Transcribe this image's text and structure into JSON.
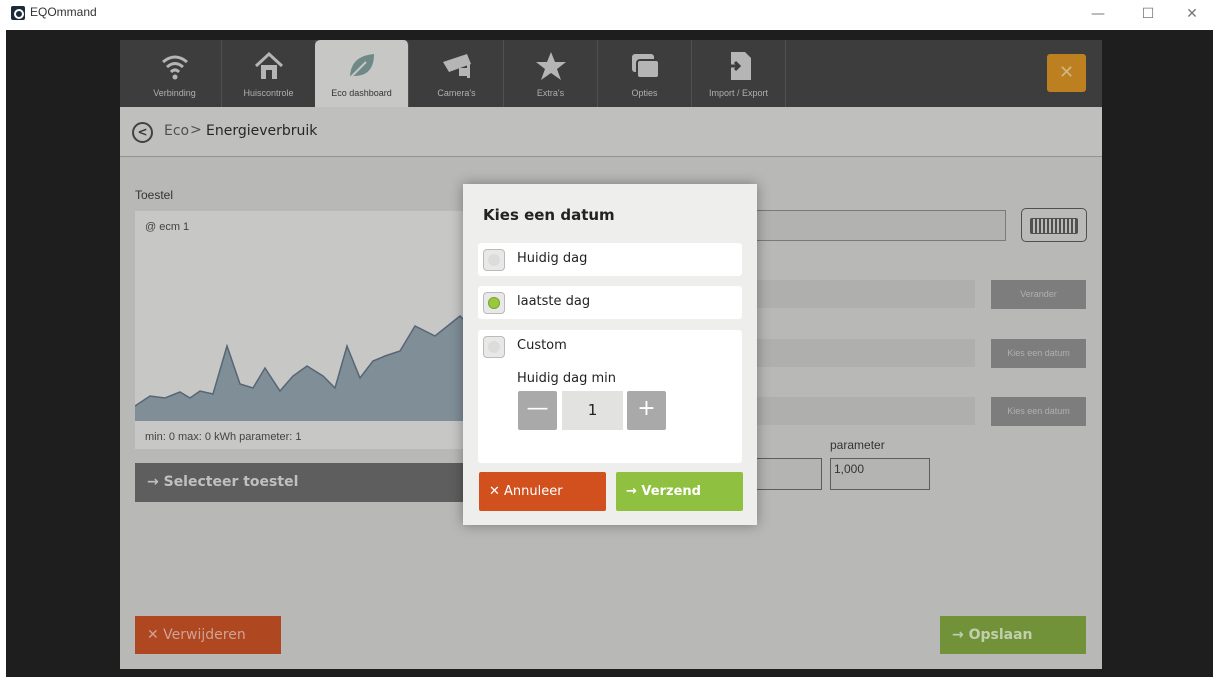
{
  "window": {
    "title": "EQOmmand",
    "minimize": "—",
    "maximize": "☐",
    "close": "✕"
  },
  "nav": {
    "tabs": [
      {
        "label": "Verbinding",
        "icon": "wifi-icon"
      },
      {
        "label": "Huiscontrole",
        "icon": "home-icon"
      },
      {
        "label": "Eco dashboard",
        "icon": "leaf-icon",
        "active": true
      },
      {
        "label": "Camera's",
        "icon": "camera-icon"
      },
      {
        "label": "Extra's",
        "icon": "star-icon"
      },
      {
        "label": "Opties",
        "icon": "windows-icon"
      },
      {
        "label": "Import / Export",
        "icon": "import-export-icon"
      }
    ],
    "close_symbol": "✕"
  },
  "breadcrumb": {
    "back": "<",
    "parent": "Eco",
    "separator": ">",
    "current": "Energieverbruik"
  },
  "form": {
    "device_label": "Toestel",
    "device_name": "@ ecm 1",
    "graph_footer": "min: 0 max: 0 kWh parameter: 1",
    "select_device": "→  Selecteer toestel",
    "change_button": "Verander",
    "pick_date_1": "Kies een datum",
    "pick_date_2": "Kies een datum",
    "parameter_label": "parameter",
    "parameter_value": "1,000",
    "delete_button": "✕  Verwijderen",
    "save_button": "→  Opslaan"
  },
  "dialog": {
    "title": "Kies een datum",
    "options": [
      {
        "label": "Huidig dag",
        "selected": false
      },
      {
        "label": "laatste dag",
        "selected": true
      },
      {
        "label": "Custom",
        "selected": false
      }
    ],
    "custom_sub_label": "Huidig dag min",
    "stepper_minus": "—",
    "stepper_value": "1",
    "stepper_plus": "+",
    "cancel": "✕  Annuleer",
    "send": "→  Verzend"
  },
  "colors": {
    "accent_orange": "#d88f1a",
    "danger": "#c84a1c",
    "success": "#8fc040"
  }
}
